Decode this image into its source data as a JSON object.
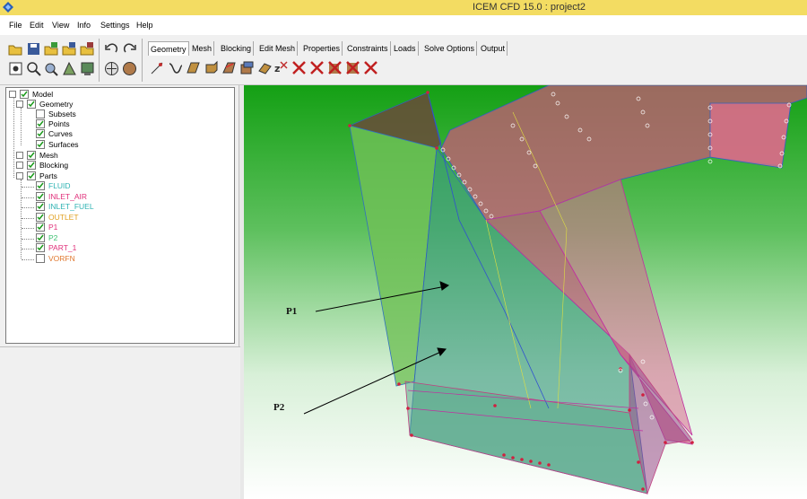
{
  "window": {
    "title": "ICEM CFD 15.0 : project2"
  },
  "menu": [
    "File",
    "Edit",
    "View",
    "Info",
    "Settings",
    "Help"
  ],
  "tabs": [
    "Geometry",
    "Mesh",
    "Blocking",
    "Edit Mesh",
    "Properties",
    "Constraints",
    "Loads",
    "Solve Options",
    "Output"
  ],
  "active_tab": "Geometry",
  "tree": {
    "model": "Model",
    "geometry": "Geometry",
    "subsets": "Subsets",
    "points": "Points",
    "curves": "Curves",
    "surfaces": "Surfaces",
    "mesh": "Mesh",
    "blocking": "Blocking",
    "parts": "Parts",
    "part_items": [
      {
        "label": "FLUID",
        "color": "#2fb3b3",
        "checked": true
      },
      {
        "label": "INLET_AIR",
        "color": "#e0307a",
        "checked": true
      },
      {
        "label": "INLET_FUEL",
        "color": "#2fb3b3",
        "checked": true
      },
      {
        "label": "OUTLET",
        "color": "#e0a020",
        "checked": true
      },
      {
        "label": "P1",
        "color": "#e0307a",
        "checked": true
      },
      {
        "label": "P2",
        "color": "#3cc070",
        "checked": true
      },
      {
        "label": "PART_1",
        "color": "#e0307a",
        "checked": true
      },
      {
        "label": "VORFN",
        "color": "#e07830",
        "checked": false
      }
    ]
  },
  "annotations": {
    "p1": "P1",
    "p2": "P2"
  },
  "colors": {
    "bg_green": "#14a014",
    "bg_white": "#ffffff",
    "pink_surface": "#d0507a",
    "green_surface": "#60b070",
    "title_bar": "#f3dc62"
  },
  "toolbar_icons": [
    "open-icon",
    "save-icon",
    "geometry-open-icon",
    "mesh-open-icon",
    "blocking-open-icon",
    "undo-icon",
    "redo-icon",
    "fit-icon",
    "zoom-icon",
    "measure-icon",
    "probe-icon",
    "display-icon",
    "shaded-icon",
    "mesh-shaded-icon",
    "create-point-icon",
    "create-curve-icon",
    "create-surface-icon",
    "create-body-icon",
    "repair-icon",
    "transform-icon",
    "restore-icon",
    "delete-point-icon",
    "delete-curve-icon",
    "delete-surface-icon",
    "delete-body-icon",
    "delete-any-icon"
  ]
}
